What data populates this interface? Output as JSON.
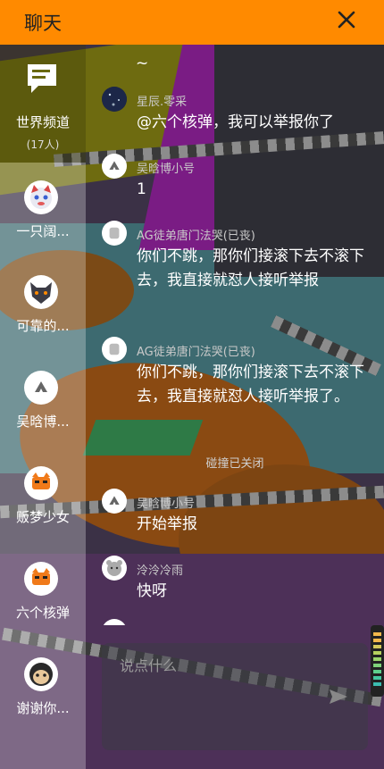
{
  "header": {
    "title": "聊天"
  },
  "sidebar": {
    "world": {
      "name": "世界频道",
      "count": "(17人)"
    },
    "users": [
      {
        "name": "一只阔...",
        "avatar": "cat-avatar"
      },
      {
        "name": "可靠的...",
        "avatar": "wolf-avatar"
      },
      {
        "name": "吴晗博...",
        "avatar": "default-avatar"
      },
      {
        "name": "贩梦少女",
        "avatar": "fox-avatar"
      },
      {
        "name": "六个核弹",
        "avatar": "fox-avatar"
      },
      {
        "name": "谢谢你...",
        "avatar": "dog-avatar"
      }
    ]
  },
  "messages": [
    {
      "author": "",
      "text": "~"
    },
    {
      "author": "星辰.零采",
      "text": "@六个核弹，我可以举报你了"
    },
    {
      "author": "吴晗博小号",
      "text": "1"
    },
    {
      "author": "AG徒弟唐门法哭(已丧)",
      "text": "你们不跳，那你们接滚下去不滚下去，我直接就怼人接听举报"
    },
    {
      "author": "AG徒弟唐门法哭(已丧)",
      "text": "你们不跳，那你们接滚下去不滚下去，我直接就怼人接听举报了。"
    },
    {
      "author": "吴晗博小号",
      "text": "开始举报"
    },
    {
      "author": "泠泠冷雨",
      "text": "快呀"
    }
  ],
  "system": {
    "collision": "碰撞已关闭"
  },
  "input": {
    "placeholder": "说点什么"
  },
  "colors": {
    "header": "#ff8a00",
    "text": "#ffffff",
    "author": "#c9c9c9"
  }
}
